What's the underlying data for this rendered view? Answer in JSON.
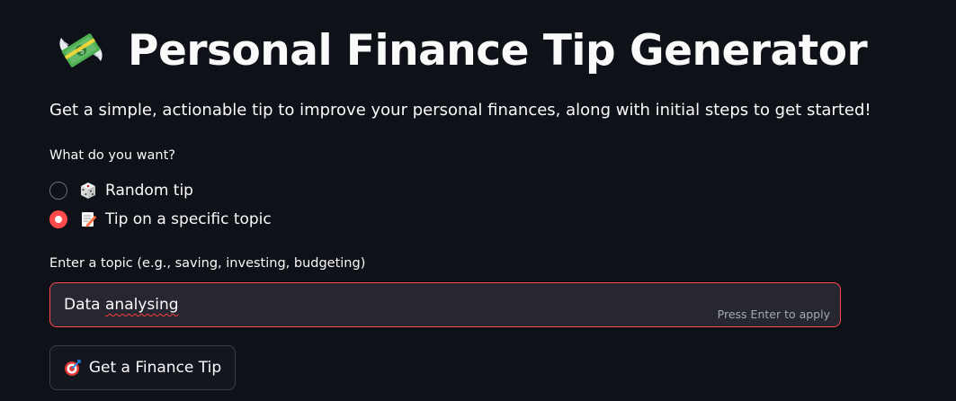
{
  "header": {
    "title_icon": "money-with-wings-icon",
    "title": "Personal Finance Tip Generator",
    "subtitle": "Get a simple, actionable tip to improve your personal finances, along with initial steps to get started!"
  },
  "mode": {
    "label": "What do you want?",
    "options": [
      {
        "icon": "die-icon",
        "label": "Random tip",
        "selected": false
      },
      {
        "icon": "memo-icon",
        "label": "Tip on a specific topic",
        "selected": true
      }
    ]
  },
  "topic": {
    "label": "Enter a topic (e.g., saving, investing, budgeting)",
    "value_word1": "Data",
    "value_word2": "analysing",
    "hint": "Press Enter to apply"
  },
  "action": {
    "icon": "direct-hit-icon",
    "label": "Get a Finance Tip"
  },
  "colors": {
    "background": "#0e1117",
    "accent": "#ff4b4b",
    "input_bg": "#262730",
    "text": "#fafafa"
  }
}
